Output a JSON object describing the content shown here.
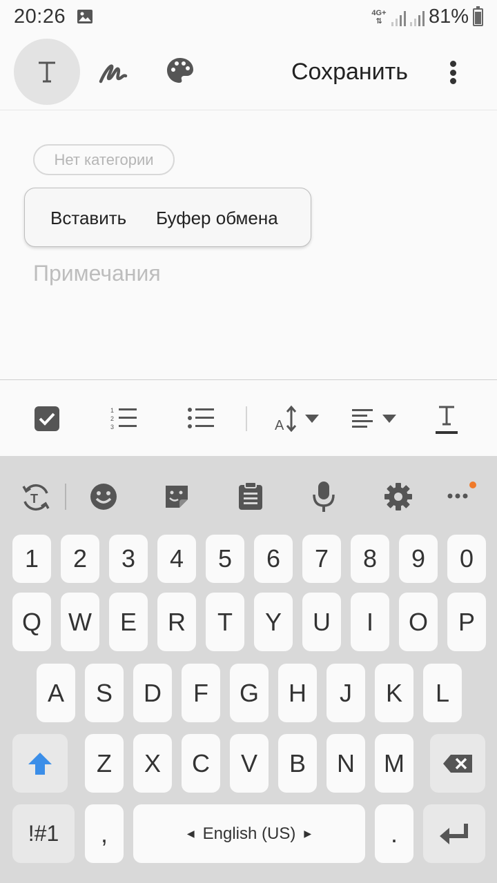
{
  "status_bar": {
    "time": "20:26",
    "network": "4G+",
    "battery": "81%",
    "battery_level": 0.81
  },
  "toolbar": {
    "text_mode_label": "T",
    "save_label": "Сохранить"
  },
  "note": {
    "category": "Нет категории",
    "placeholder": "Примечания"
  },
  "context_menu": {
    "items": [
      "Вставить",
      "Буфер обмена"
    ]
  },
  "format_bar": {
    "icons": [
      "checkbox-icon",
      "numbered-list-icon",
      "bullet-list-icon",
      "font-size-icon",
      "align-icon",
      "text-color-icon"
    ],
    "text_color_glyph": "T"
  },
  "keyboard": {
    "tools": [
      "translate-icon",
      "emoji-icon",
      "sticker-icon",
      "clipboard-icon",
      "mic-icon",
      "settings-icon",
      "more-icon"
    ],
    "numbers": [
      "1",
      "2",
      "3",
      "4",
      "5",
      "6",
      "7",
      "8",
      "9",
      "0"
    ],
    "row1": [
      "Q",
      "W",
      "E",
      "R",
      "T",
      "Y",
      "U",
      "I",
      "O",
      "P"
    ],
    "row2": [
      "A",
      "S",
      "D",
      "F",
      "G",
      "H",
      "J",
      "K",
      "L"
    ],
    "row3": [
      "Z",
      "X",
      "C",
      "V",
      "B",
      "N",
      "M"
    ],
    "symbols_label": "!#1",
    "comma": ",",
    "space_label": "English (US)",
    "period": ".",
    "accent": "#3b8ee8"
  }
}
